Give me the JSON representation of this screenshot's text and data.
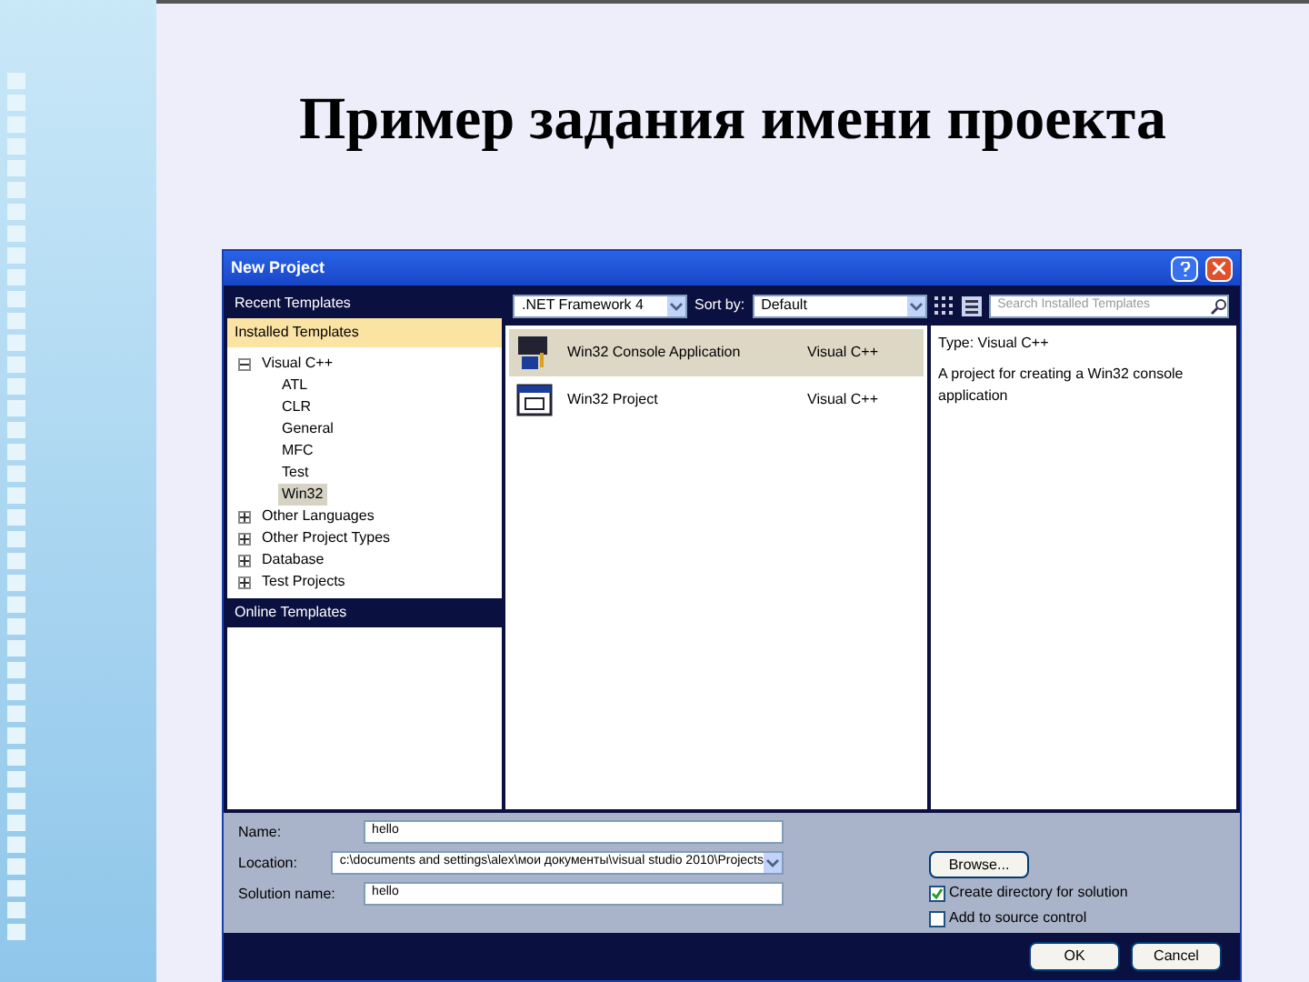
{
  "slide": {
    "title": "Пример задания имени проекта"
  },
  "dialog": {
    "title": "New Project",
    "sections": [
      {
        "label": "Recent Templates",
        "selected": false
      },
      {
        "label": "Installed Templates",
        "selected": true
      }
    ],
    "tree": [
      {
        "label": "Visual C++",
        "expanded": true,
        "selected": false,
        "children": [
          {
            "label": "ATL",
            "selected": false
          },
          {
            "label": "CLR",
            "selected": false
          },
          {
            "label": "General",
            "selected": false
          },
          {
            "label": "MFC",
            "selected": false
          },
          {
            "label": "Test",
            "selected": false
          },
          {
            "label": "Win32",
            "selected": true
          }
        ]
      },
      {
        "label": "Other Languages",
        "expanded": false,
        "selected": false
      },
      {
        "label": "Other Project Types",
        "expanded": false,
        "selected": false
      },
      {
        "label": "Database",
        "expanded": false,
        "selected": false
      },
      {
        "label": "Test Projects",
        "expanded": false,
        "selected": false
      }
    ],
    "online": {
      "label": "Online Templates"
    },
    "toolbar": {
      "framework": ".NET Framework 4",
      "sort_label": "Sort by:",
      "sort": "Default",
      "search_placeholder": "Search Installed Templates"
    },
    "templates": [
      {
        "name": "Win32 Console Application",
        "language": "Visual C++",
        "selected": true
      },
      {
        "name": "Win32 Project",
        "language": "Visual C++",
        "selected": false
      }
    ],
    "details": {
      "type": "Type: Visual C++",
      "description": "A project for creating a Win32 console application"
    },
    "form": {
      "name_label": "Name:",
      "name": "hello",
      "location_label": "Location:",
      "location": "c:\\documents and settings\\alex\\мои документы\\visual studio 2010\\Projects",
      "solution_label": "Solution name:",
      "solution": "hello",
      "browse": "Browse...",
      "options": [
        {
          "label": "Create directory for solution",
          "checked": true
        },
        {
          "label": "Add to source control",
          "checked": false
        }
      ]
    },
    "buttons": [
      "OK",
      "Cancel"
    ]
  }
}
